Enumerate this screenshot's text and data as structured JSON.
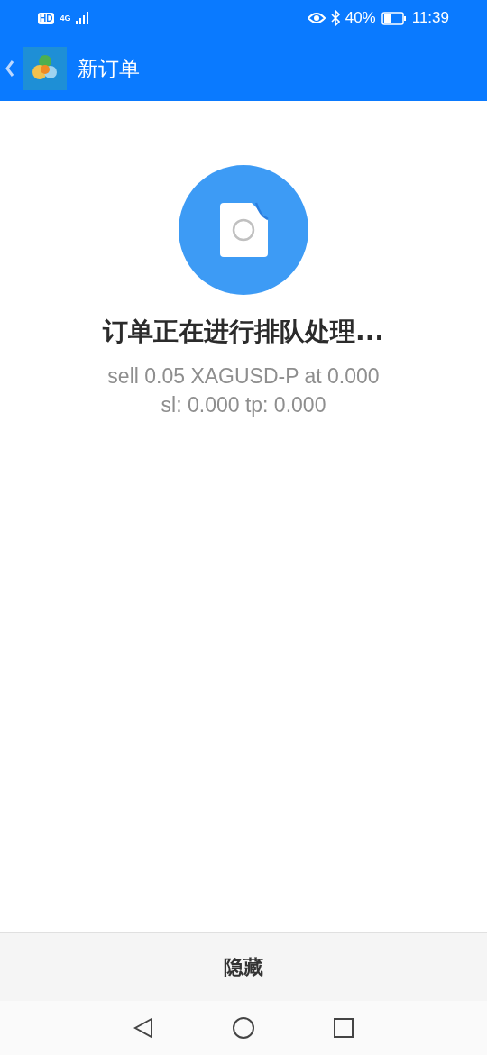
{
  "status_bar": {
    "badge": "HD",
    "network": "4G",
    "battery": "40%",
    "time": "11:39"
  },
  "app_bar": {
    "title": "新订单"
  },
  "message": {
    "title": "订单正在进行排队处理...",
    "lines": [
      "sell 0.05 XAGUSD-P at 0.000",
      "sl: 0.000 tp: 0.000"
    ]
  },
  "footer_button": "隐藏"
}
